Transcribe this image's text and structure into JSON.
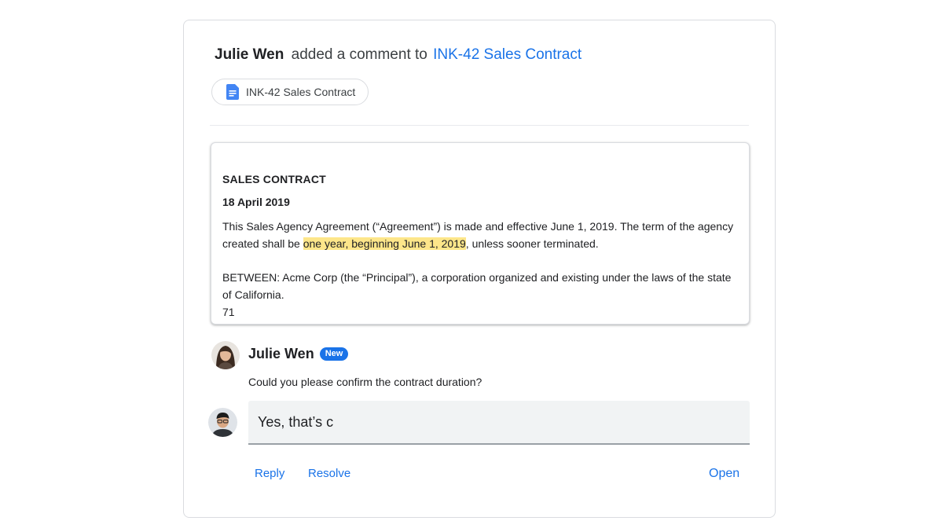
{
  "header": {
    "author": "Julie Wen",
    "action": "added a comment to",
    "doc_link": "INK-42 Sales Contract"
  },
  "chip": {
    "label": "INK-42 Sales Contract",
    "icon": "google-docs-icon"
  },
  "excerpt": {
    "title": "SALES CONTRACT",
    "date": "18 April 2019",
    "para1_before": "This Sales Agency Agreement (“Agreement”) is made and effective June 1, 2019. The term of the agency created shall be ",
    "para1_highlight": "one year, beginning June 1, 2019",
    "para1_after": ", unless sooner terminated.",
    "para2": "BETWEEN: Acme Corp (the “Principal”), a corporation organized and existing under the laws of the state of California.",
    "page_number": "71"
  },
  "comment": {
    "author": "Julie Wen",
    "badge": "New",
    "text": "Could you please confirm the contract duration?"
  },
  "reply": {
    "value": "Yes, that’s c"
  },
  "actions": {
    "reply": "Reply",
    "resolve": "Resolve",
    "open": "Open"
  },
  "colors": {
    "link": "#1a73e8",
    "highlight": "#fde68a",
    "badge": "#1a73e8"
  }
}
